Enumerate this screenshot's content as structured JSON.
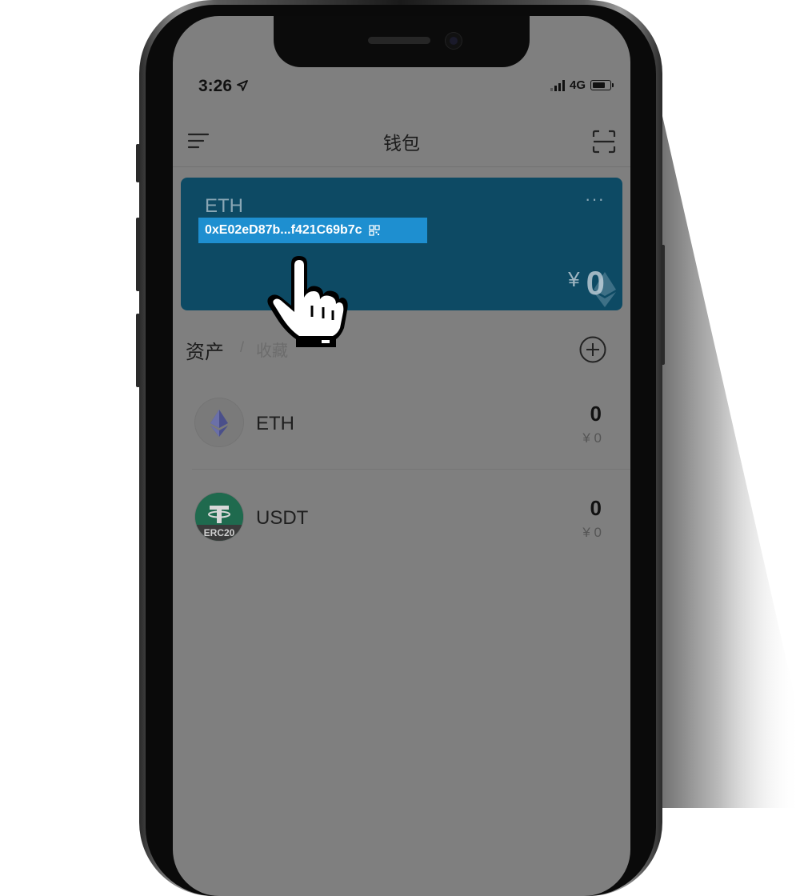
{
  "status_bar": {
    "time": "3:26",
    "location_arrow": "location-arrow-icon",
    "network": "4G"
  },
  "nav": {
    "title": "钱包",
    "left_icon": "menu-icon",
    "right_icon": "scan-icon"
  },
  "wallet_card": {
    "chain": "ETH",
    "more": "···",
    "address": "0xE02eD87b...f421C69b7c",
    "currency": "¥",
    "balance": "0",
    "color": "#0d4a64",
    "address_highlight": "#1e8fd0"
  },
  "tabs": {
    "assets": "资产",
    "separator": "/",
    "collections": "收藏"
  },
  "assets": [
    {
      "name": "ETH",
      "amount": "0",
      "fiat": "¥ 0",
      "icon": "ethereum-icon"
    },
    {
      "name": "USDT",
      "amount": "0",
      "fiat": "¥ 0",
      "icon": "tether-erc20-icon",
      "badge": "ERC20"
    }
  ],
  "overlay": {
    "pointer": "pointing-hand-icon"
  }
}
